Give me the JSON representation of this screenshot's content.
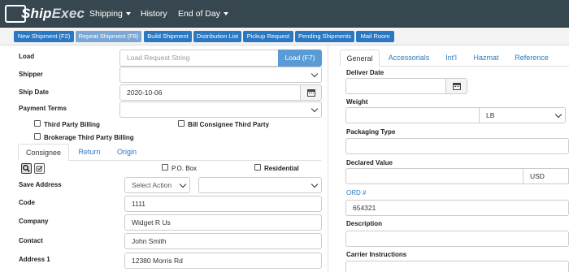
{
  "app": {
    "logo_ship": "Ship",
    "logo_exec": "Exec"
  },
  "nav": {
    "shipping": "Shipping",
    "history": "History",
    "end_of_day": "End of Day"
  },
  "toolbar": {
    "new_shipment": "New Shipment (F2)",
    "repeat_shipment": "Repeat Shipment (F8)",
    "build_shipment": "Build Shipment",
    "distribution_list": "Distribution List",
    "pickup_request": "Pickup Request",
    "pending_shipments": "Pending Shipments",
    "mail_room": "Mail Room"
  },
  "form": {
    "load_label": "Load",
    "load_placeholder": "Load Request String",
    "load_button": "Load (F7)",
    "shipper_label": "Shipper",
    "ship_date_label": "Ship Date",
    "ship_date_value": "2020-10-06",
    "payment_terms_label": "Payment Terms",
    "third_party_billing": "Third Party Billing",
    "bill_consignee": "Bill Consignee Third Party",
    "brokerage": "Brokerage Third Party Billing"
  },
  "address_tabs": {
    "consignee": "Consignee",
    "return": "Return",
    "origin": "Origin"
  },
  "address": {
    "po_box": "P.O. Box",
    "residential": "Residential",
    "save_address_label": "Save Address",
    "select_action": "Select Action",
    "code_label": "Code",
    "code_value": "1111",
    "company_label": "Company",
    "company_value": "Widget R Us",
    "contact_label": "Contact",
    "contact_value": "John Smith",
    "address1_label": "Address 1",
    "address1_value": "12380 Morris Rd"
  },
  "right_tabs": {
    "general": "General",
    "accessorials": "Accessorials",
    "intl": "Int'l",
    "hazmat": "Hazmat",
    "reference": "Reference"
  },
  "general": {
    "deliver_date_label": "Deliver Date",
    "weight_label": "Weight",
    "weight_unit": "LB",
    "packaging_type_label": "Packaging Type",
    "declared_value_label": "Declared Value",
    "currency": "USD",
    "ord_label": "ORD #",
    "ord_value": "654321",
    "description_label": "Description",
    "carrier_instructions_label": "Carrier Instructions"
  },
  "colors": {
    "navbar": "#37474f",
    "primary": "#2b78c2",
    "load_button": "#5b9bd5"
  }
}
